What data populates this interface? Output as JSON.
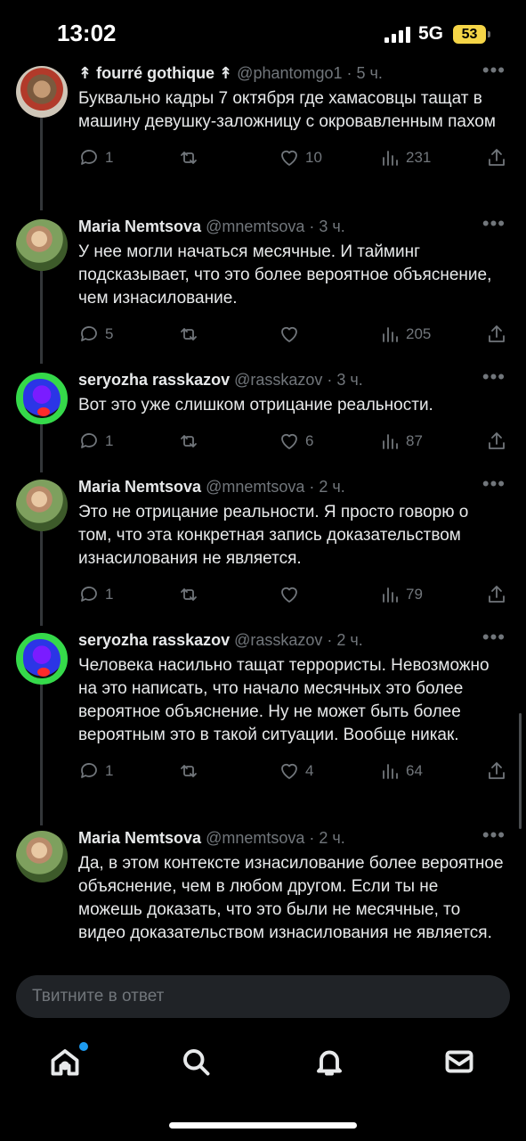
{
  "status_bar": {
    "time": "13:02",
    "network": "5G",
    "battery": "53"
  },
  "tweets": [
    {
      "name": "↟ fourré gothique ↟",
      "handle": "@phantomgo1 · 5 ч.",
      "text": "Буквально кадры 7 октября где хамасовцы тащат в машину девушку-заложницу с окровавленным пахом",
      "replies": "1",
      "retweets": "",
      "likes": "10",
      "views": "231"
    },
    {
      "name": "Maria Nemtsova",
      "handle": "@mnemtsova · 3 ч.",
      "text": "У нее могли начаться месячные. И тайминг подсказывает, что это более вероятное объяснение, чем изнасилование.",
      "replies": "5",
      "retweets": "",
      "likes": "",
      "views": "205"
    },
    {
      "name": "seryozha rasskazov",
      "handle": "@rasskazov · 3 ч.",
      "text": "Вот это уже слишком отрицание реальности.",
      "replies": "1",
      "retweets": "",
      "likes": "6",
      "views": "87"
    },
    {
      "name": "Maria Nemtsova",
      "handle": "@mnemtsova · 2 ч.",
      "text": "Это не отрицание реальности. Я просто говорю о том, что эта конкретная запись доказательством изнасилования не является.",
      "replies": "1",
      "retweets": "",
      "likes": "",
      "views": "79"
    },
    {
      "name": "seryozha rasskazov",
      "handle": "@rasskazov · 2 ч.",
      "text": "Человека насильно тащат террористы. Невозможно на это написать, что начало месячных это более вероятное объяснение. Ну не может быть более вероятным это в такой ситуации. Вообще никак.",
      "replies": "1",
      "retweets": "",
      "likes": "4",
      "views": "64"
    },
    {
      "name": "Maria Nemtsova",
      "handle": "@mnemtsova · 2 ч.",
      "text": "Да, в этом контексте изнасилование более вероятное объяснение, чем в любом другом. Если ты не можешь доказать, что это были не месячные, то видео доказательством изнасилования не является.",
      "replies": "",
      "retweets": "",
      "likes": "",
      "views": ""
    }
  ],
  "more_glyph": "•••",
  "reply_input": {
    "placeholder": "Твитните в ответ"
  },
  "icons": {
    "reply": "reply-icon",
    "retweet": "retweet-icon",
    "like": "heart-icon",
    "views": "views-icon",
    "share": "share-icon"
  },
  "colors": {
    "background": "#000000",
    "text": "#e7e9ea",
    "muted": "#71767b",
    "accent": "#1d9bf0",
    "battery": "#f5d547"
  }
}
